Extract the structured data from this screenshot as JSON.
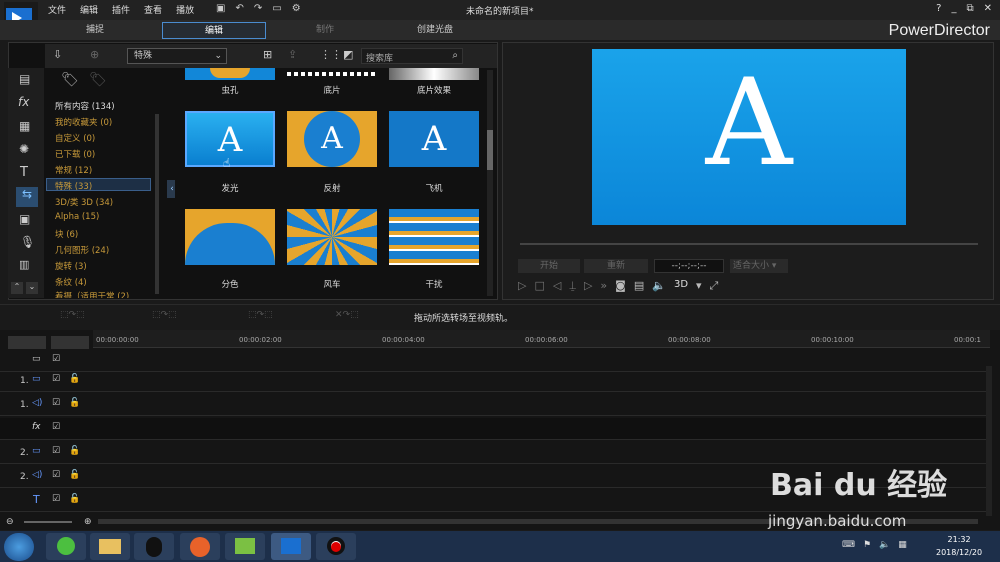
{
  "menu": {
    "file": "文件",
    "edit": "编辑",
    "plugin": "插件",
    "view": "查看",
    "play": "播放"
  },
  "title": "未命名的新项目*",
  "window_controls": {
    "help": "?",
    "minimize": "_",
    "restore": "⧉",
    "close": "✕"
  },
  "tabs": {
    "capture": "捕捉",
    "edit": "编辑",
    "produce": "制作",
    "disc": "创建光盘"
  },
  "brand": "PowerDirector",
  "library": {
    "dropdown": "特殊",
    "search_placeholder": "搜索库"
  },
  "categories": [
    "所有内容 (134)",
    "我的收藏夹 (0)",
    "自定义 (0)",
    "已下载 (0)",
    "常规 (12)",
    "特殊 (33)",
    "3D/类 3D (34)",
    "Alpha (15)",
    "块 (6)",
    "几何图形 (24)",
    "旋转 (3)",
    "条纹 (4)",
    "着摄（适用于常 (2)"
  ],
  "thumbs": [
    "虫孔",
    "底片",
    "底片效果",
    "发光",
    "反射",
    "飞机",
    "分色",
    "风车",
    "干扰"
  ],
  "preview": {
    "glyph": "A",
    "btn1": "开始",
    "btn2": "重新",
    "timecode": "--;--;--;--",
    "fit": "适合大小",
    "three_d": "3D"
  },
  "status_hint": "拖动所选转场至视频轨。",
  "ruler": [
    "00:00:00:00",
    "00:00:02:00",
    "00:00:04:00",
    "00:00:06:00",
    "00:00:08:00",
    "00:00:10:00",
    "00:00:1"
  ],
  "tracks": [
    "",
    "1.",
    "1.",
    "fx",
    "2.",
    "2.",
    "T"
  ],
  "clock": {
    "time": "21:32",
    "date": "2018/12/20"
  },
  "watermark": {
    "logo": "Bai du 经验",
    "url": "jingyan.baidu.com"
  },
  "colors": {
    "accent": "#4a8cd0",
    "cat_text": "#c89a3a",
    "taskbar": "#1d2f4a"
  }
}
